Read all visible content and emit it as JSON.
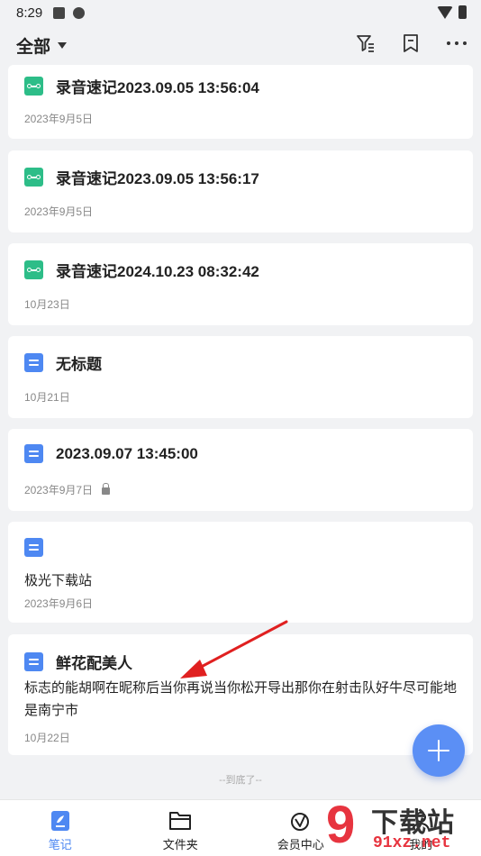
{
  "status": {
    "time": "8:29"
  },
  "toolbar": {
    "filter_label": "全部"
  },
  "notes": [
    {
      "type": "audio",
      "title": "录音速记2023.09.05 13:56:04",
      "body": "",
      "date": "2023年9月5日",
      "locked": false
    },
    {
      "type": "audio",
      "title": "录音速记2023.09.05 13:56:17",
      "body": "",
      "date": "2023年9月5日",
      "locked": false
    },
    {
      "type": "audio",
      "title": "录音速记2024.10.23 08:32:42",
      "body": "",
      "date": "10月23日",
      "locked": false
    },
    {
      "type": "doc",
      "title": "无标题",
      "body": "",
      "date": "10月21日",
      "locked": false
    },
    {
      "type": "doc",
      "title": "2023.09.07 13:45:00",
      "body": "",
      "date": "2023年9月7日",
      "locked": true
    },
    {
      "type": "doc",
      "title": "",
      "body": "极光下载站",
      "date": "2023年9月6日",
      "locked": false
    },
    {
      "type": "doc",
      "title": "鲜花配美人",
      "body": "标志的能胡啊在昵称后当你再说当你松开导出那你在射击队好牛尽可能地是南宁市",
      "date": "10月22日",
      "locked": false
    }
  ],
  "list_end": "--到底了--",
  "tabs": [
    {
      "label": "笔记",
      "icon": "note-tab-icon",
      "active": true
    },
    {
      "label": "文件夹",
      "icon": "folder-tab-icon",
      "active": false
    },
    {
      "label": "会员中心",
      "icon": "member-tab-icon",
      "active": false
    },
    {
      "label": "我的",
      "icon": "profile-tab-icon",
      "active": false
    }
  ],
  "watermark": {
    "big": "下载站",
    "small": "91xz.net",
    "digit": "9"
  },
  "colors": {
    "accent": "#4e88f2",
    "audio": "#2dbd88",
    "annotation": "#e02020",
    "background": "#f1f2f4"
  }
}
